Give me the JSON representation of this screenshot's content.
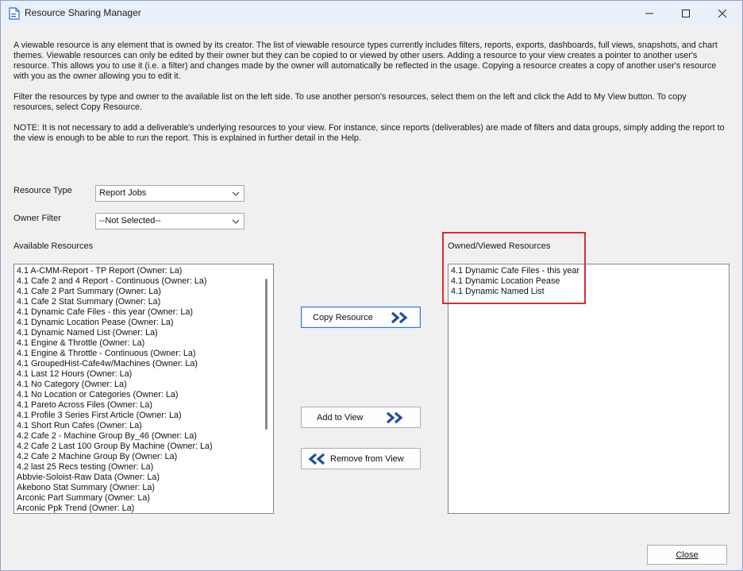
{
  "window": {
    "title": "Resource Sharing Manager",
    "icon": "document-icon"
  },
  "description": {
    "p1": "A viewable resource is any element that is owned by its creator. The list of viewable resource types currently includes filters, reports, exports, dashboards, full views, snapshots, and chart themes. Viewable resources can only be edited by their owner but they can be copied to or viewed by other users. Adding a resource to your view creates a pointer to another user's resource. This allows you to use it (i.e. a filter) and changes made by the owner will automatically be reflected in the usage. Copying a resource creates a copy of another user's resource with you as the owner allowing you to edit it.",
    "p2": "Filter the resources by type and owner to the available list on the left side. To use another person's resources, select them on the left and click the Add to My View button. To copy resources, select Copy Resource.",
    "p3": "NOTE: It is not necessary to add a deliverable's underlying resources to your view. For instance, since reports (deliverables) are made of filters and data groups, simply adding the report to the view is enough to be able to run the report. This is explained in further detail in the Help."
  },
  "filters": {
    "resource_type_label": "Resource Type",
    "resource_type_value": "Report Jobs",
    "owner_filter_label": "Owner Filter",
    "owner_filter_value": "--Not Selected--"
  },
  "available": {
    "label": "Available Resources",
    "items": [
      "4.1 A-CMM-Report - TP Report (Owner: La)",
      "4.1 Cafe 2 and 4 Report - Continuous (Owner: La)",
      "4.1 Cafe 2 Part Summary (Owner: La)",
      "4.1 Cafe 2 Stat Summary (Owner: La)",
      "4.1 Dynamic Cafe Files - this year (Owner: La)",
      "4.1 Dynamic Location Pease (Owner: La)",
      "4.1 Dynamic Named List (Owner: La)",
      "4.1 Engine & Throttle (Owner: La)",
      "4.1 Engine & Throttle - Continuous (Owner: La)",
      "4.1 GroupedHist-Cafe4w/Machines (Owner: La)",
      "4.1 Last 12 Hours (Owner: La)",
      "4.1 No Category (Owner: La)",
      "4.1 No Location or Categories (Owner: La)",
      "4.1 Pareto Across Files (Owner: La)",
      "4.1 Profile 3 Series First Article (Owner: La)",
      "4.1 Short Run Cafes (Owner: La)",
      "4.2 Cafe 2 - Machine Group By_46 (Owner: La)",
      "4.2 Cafe 2 Last 100 Group By Machine (Owner: La)",
      "4.2 Cafe 2 Machine Group By (Owner: La)",
      "4.2 last 25 Recs testing (Owner: La)",
      "Abbvie-Soloist-Raw Data (Owner: La)",
      "Akebono Stat Summary (Owner: La)",
      "Arconic Part Summary (Owner: La)",
      "Arconic Ppk Trend (Owner: La)"
    ]
  },
  "owned": {
    "label": "Owned/Viewed Resources",
    "items": [
      "4.1 Dynamic Cafe Files - this year",
      "4.1 Dynamic Location Pease",
      "4.1 Dynamic Named List"
    ]
  },
  "buttons": {
    "copy": "Copy Resource",
    "add": "Add to View",
    "remove": "Remove from View",
    "close": "Close"
  },
  "colors": {
    "accent": "#1f4e9a",
    "highlight": "#d32f2f"
  }
}
